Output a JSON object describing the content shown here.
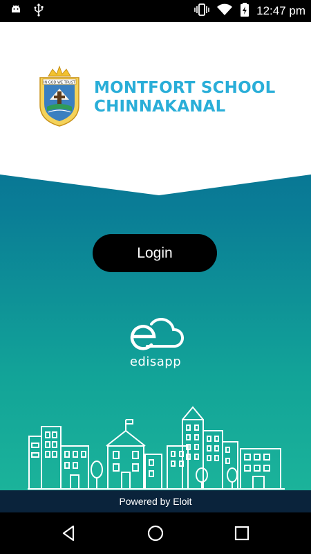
{
  "status_bar": {
    "time": "12:47 pm",
    "icons": [
      "android-icon",
      "usb-icon",
      "vibrate-icon",
      "wifi-icon",
      "battery-charging-icon"
    ]
  },
  "school": {
    "name_line1": "MONTFORT SCHOOL",
    "name_line2": "CHINNAKANAL",
    "logo_motto": "IN GOD WE TRUST"
  },
  "login": {
    "label": "Login"
  },
  "brand": {
    "name": "edisapp"
  },
  "footer": {
    "powered_by": "Powered by Eloit"
  },
  "nav": {
    "icons": [
      "back-icon",
      "home-icon",
      "recents-icon"
    ]
  },
  "colors": {
    "school_title": "#2aaed8",
    "gradient_top": "#04608e",
    "gradient_bottom": "#1bb39a",
    "footer_bar": "#0a233b",
    "button": "#000000"
  }
}
